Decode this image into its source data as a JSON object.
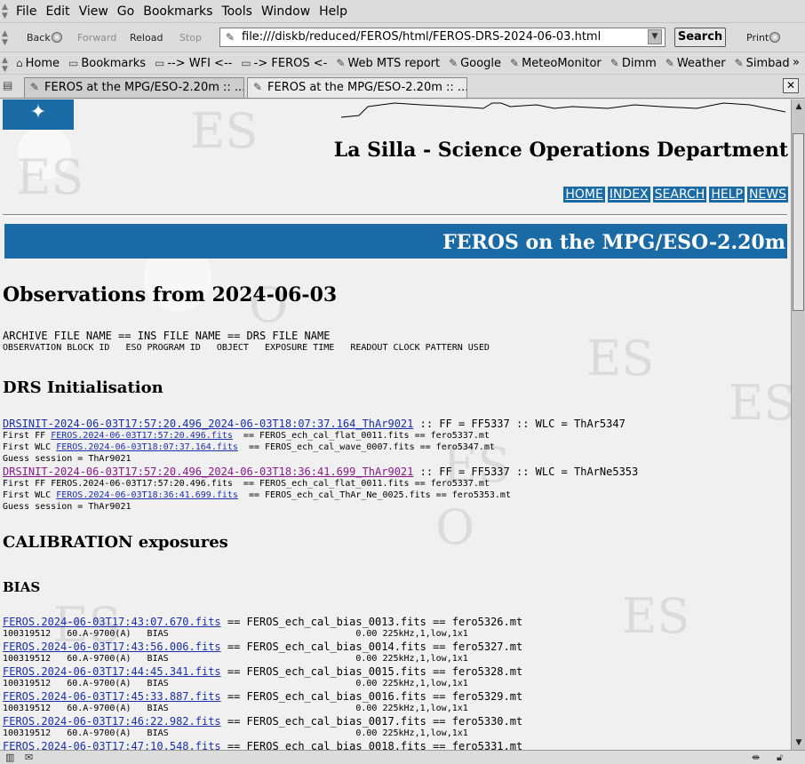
{
  "menubar": {
    "items": [
      "File",
      "Edit",
      "View",
      "Go",
      "Bookmarks",
      "Tools",
      "Window",
      "Help"
    ]
  },
  "navbar": {
    "back": "Back",
    "forward": "Forward",
    "reload": "Reload",
    "stop": "Stop",
    "url": "file:///diskb/reduced/FEROS/html/FEROS-DRS-2024-06-03.html",
    "search": "Search",
    "print": "Print"
  },
  "bookmarks": {
    "items": [
      "Home",
      "Bookmarks",
      "--> WFI <--",
      "-> FEROS <-",
      "Web MTS report",
      "Google",
      "MeteoMonitor",
      "Dimm",
      "Weather",
      "Simbad"
    ],
    "more": "»"
  },
  "tabs": [
    {
      "label": "FEROS at the MPG/ESO-2.20m :: ..."
    },
    {
      "label": "FEROS at the MPG/ESO-2.20m :: ..."
    }
  ],
  "page": {
    "department": "La Silla - Science Operations Department",
    "nav": [
      "HOME",
      "INDEX",
      "SEARCH",
      "HELP",
      "NEWS"
    ],
    "banner": "FEROS on the MPG/ESO-2.20m",
    "title": "Observations from 2024-06-03",
    "legend1": "ARCHIVE FILE NAME == INS FILE NAME == DRS FILE NAME",
    "legend2": "OBSERVATION BLOCK ID   ESO PROGRAM ID   OBJECT   EXPOSURE TIME   READOUT CLOCK PATTERN USED",
    "drs_heading": "DRS Initialisation",
    "drs": [
      {
        "link": "DRSINIT-2024-06-03T17:57:20.496_2024-06-03T18:07:37.164_ThAr9021",
        "tail": " :: FF = FF5337 :: WLC = ThAr5347",
        "ff_prefix": "First FF ",
        "ff_link": "FEROS.2024-06-03T17:57:20.496.fits",
        "ff_link_style": "link",
        "ff_tail": "  == FEROS_ech_cal_flat_0011.fits == fero5337.mt",
        "wlc_prefix": "First WLC ",
        "wlc_link": "FEROS.2024-06-03T18:07:37.164.fits",
        "wlc_tail": "  == FEROS_ech_cal_wave_0007.fits == fero5347.mt",
        "guess": "Guess session = ThAr9021"
      },
      {
        "link": "DRSINIT-2024-06-03T17:57:20.496_2024-06-03T18:36:41.699_ThAr9021",
        "tail": " :: FF = FF5337 :: WLC = ThArNe5353",
        "ff_prefix": "First FF ",
        "ff_link": "FEROS.2024-06-03T17:57:20.496.fits",
        "ff_link_style": "plain",
        "ff_tail": "  == FEROS_ech_cal_flat_0011.fits == fero5337.mt",
        "wlc_prefix": "First WLC ",
        "wlc_link": "FEROS.2024-06-03T18:36:41.699.fits",
        "wlc_tail": "  == FEROS_ech_cal_ThAr_Ne_0025.fits == fero5353.mt",
        "guess": "Guess session = ThAr9021"
      }
    ],
    "cal_heading": "CALIBRATION exposures",
    "bias_heading": "BIAS",
    "bias": [
      {
        "link": "FEROS.2024-06-03T17:43:07.670.fits",
        "tail": " == FEROS_ech_cal_bias_0013.fits == fero5326.mt",
        "info": "100319512   60.A-9700(A)   BIAS                                   0.00 225kHz,1,low,1x1"
      },
      {
        "link": "FEROS.2024-06-03T17:43:56.006.fits",
        "tail": " == FEROS_ech_cal_bias_0014.fits == fero5327.mt",
        "info": "100319512   60.A-9700(A)   BIAS                                   0.00 225kHz,1,low,1x1"
      },
      {
        "link": "FEROS.2024-06-03T17:44:45.341.fits",
        "tail": " == FEROS_ech_cal_bias_0015.fits == fero5328.mt",
        "info": "100319512   60.A-9700(A)   BIAS                                   0.00 225kHz,1,low,1x1"
      },
      {
        "link": "FEROS.2024-06-03T17:45:33.887.fits",
        "tail": " == FEROS_ech_cal_bias_0016.fits == fero5329.mt",
        "info": "100319512   60.A-9700(A)   BIAS                                   0.00 225kHz,1,low,1x1"
      },
      {
        "link": "FEROS.2024-06-03T17:46:22.982.fits",
        "tail": " == FEROS_ech_cal_bias_0017.fits == fero5330.mt",
        "info": "100319512   60.A-9700(A)   BIAS                                   0.00 225kHz,1,low,1x1"
      },
      {
        "link": "FEROS.2024-06-03T17:47:10.548.fits",
        "tail": " == FEROS_ech_cal_bias_0018.fits == fero5331.mt",
        "info": ""
      }
    ]
  },
  "colors": {
    "eso_blue": "#1a6aa6",
    "link": "#1a2fae",
    "visited": "#8a1a8a"
  }
}
